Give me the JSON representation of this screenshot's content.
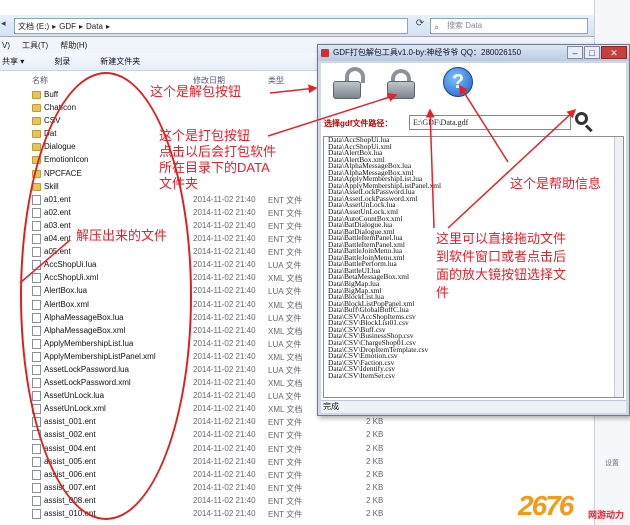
{
  "explorer": {
    "breadcrumb": [
      "文档 (E:)",
      "GDF",
      "Data"
    ],
    "search_placeholder": "搜索 Data",
    "menu": [
      "V)",
      "工具(T)",
      "帮助(H)"
    ],
    "toolbar": [
      "共享 ▾",
      "刻录",
      "新建文件夹"
    ],
    "columns": {
      "name": "名称",
      "date": "修改日期",
      "type": "类型"
    },
    "files": [
      {
        "name": "Buff",
        "date": "",
        "type": "",
        "size": "",
        "kind": "folder"
      },
      {
        "name": "ChatIcon",
        "date": "",
        "type": "",
        "size": "",
        "kind": "folder"
      },
      {
        "name": "CSV",
        "date": "",
        "type": "",
        "size": "",
        "kind": "folder"
      },
      {
        "name": "Dat",
        "date": "",
        "type": "",
        "size": "",
        "kind": "folder"
      },
      {
        "name": "Dialogue",
        "date": "",
        "type": "",
        "size": "",
        "kind": "folder"
      },
      {
        "name": "EmotionIcon",
        "date": "",
        "type": "",
        "size": "",
        "kind": "folder"
      },
      {
        "name": "NPCFACE",
        "date": "",
        "type": "",
        "size": "",
        "kind": "folder"
      },
      {
        "name": "Skill",
        "date": "",
        "type": "",
        "size": "",
        "kind": "folder"
      },
      {
        "name": "a01.ent",
        "date": "2014-11-02 21:40",
        "type": "ENT 文件",
        "size": "",
        "kind": "doc"
      },
      {
        "name": "a02.ent",
        "date": "2014-11-02 21:40",
        "type": "ENT 文件",
        "size": "",
        "kind": "doc"
      },
      {
        "name": "a03.ent",
        "date": "2014-11-02 21:40",
        "type": "ENT 文件",
        "size": "",
        "kind": "doc"
      },
      {
        "name": "a04.ent",
        "date": "2014-11-02 21:40",
        "type": "ENT 文件",
        "size": "",
        "kind": "doc"
      },
      {
        "name": "a05.ent",
        "date": "2014-11-02 21:40",
        "type": "ENT 文件",
        "size": "",
        "kind": "doc"
      },
      {
        "name": "AccShopUi.lua",
        "date": "2014-11-02 21:40",
        "type": "LUA 文件",
        "size": "",
        "kind": "doc"
      },
      {
        "name": "AccShopUi.xml",
        "date": "2014-11-02 21:40",
        "type": "XML 文档",
        "size": "",
        "kind": "doc"
      },
      {
        "name": "AlertBox.lua",
        "date": "2014-11-02 21:40",
        "type": "LUA 文件",
        "size": "",
        "kind": "doc"
      },
      {
        "name": "AlertBox.xml",
        "date": "2014-11-02 21:40",
        "type": "XML 文档",
        "size": "",
        "kind": "doc"
      },
      {
        "name": "AlphaMessageBox.lua",
        "date": "2014-11-02 21:40",
        "type": "LUA 文件",
        "size": "",
        "kind": "doc"
      },
      {
        "name": "AlphaMessageBox.xml",
        "date": "2014-11-02 21:40",
        "type": "XML 文档",
        "size": "",
        "kind": "doc"
      },
      {
        "name": "ApplyMembershipList.lua",
        "date": "2014-11-02 21:40",
        "type": "LUA 文件",
        "size": "",
        "kind": "doc"
      },
      {
        "name": "ApplyMembershipListPanel.xml",
        "date": "2014-11-02 21:40",
        "type": "XML 文档",
        "size": "",
        "kind": "doc"
      },
      {
        "name": "AssetLockPassword.lua",
        "date": "2014-11-02 21:40",
        "type": "LUA 文件",
        "size": "",
        "kind": "doc"
      },
      {
        "name": "AssetLockPassword.xml",
        "date": "2014-11-02 21:40",
        "type": "XML 文档",
        "size": "",
        "kind": "doc"
      },
      {
        "name": "AssetUnLock.lua",
        "date": "2014-11-02 21:40",
        "type": "LUA 文件",
        "size": "",
        "kind": "doc"
      },
      {
        "name": "AssetUnLock.xml",
        "date": "2014-11-02 21:40",
        "type": "XML 文档",
        "size": "",
        "kind": "doc"
      },
      {
        "name": "assist_001.ent",
        "date": "2014-11-02 21:40",
        "type": "ENT 文件",
        "size": "2 KB",
        "kind": "doc"
      },
      {
        "name": "assist_002.ent",
        "date": "2014-11-02 21:40",
        "type": "ENT 文件",
        "size": "2 KB",
        "kind": "doc"
      },
      {
        "name": "assist_004.ent",
        "date": "2014-11-02 21:40",
        "type": "ENT 文件",
        "size": "2 KB",
        "kind": "doc"
      },
      {
        "name": "assist_005.ent",
        "date": "2014-11-02 21:40",
        "type": "ENT 文件",
        "size": "2 KB",
        "kind": "doc"
      },
      {
        "name": "assist_006.ent",
        "date": "2014-11-02 21:40",
        "type": "ENT 文件",
        "size": "2 KB",
        "kind": "doc"
      },
      {
        "name": "assist_007.ent",
        "date": "2014-11-02 21:40",
        "type": "ENT 文件",
        "size": "2 KB",
        "kind": "doc"
      },
      {
        "name": "assist_008.ent",
        "date": "2014-11-02 21:40",
        "type": "ENT 文件",
        "size": "2 KB",
        "kind": "doc"
      },
      {
        "name": "assist_010.ent",
        "date": "2014-11-02 21:40",
        "type": "ENT 文件",
        "size": "2 KB",
        "kind": "doc"
      }
    ],
    "status_right": "设置"
  },
  "tool": {
    "title": "GDF打包解包工具v1.0-by:神经爷爷 QQ：280026150",
    "path_label": "选择gdf文件路径：",
    "path_value": "E:\\GDF\\Data.gdf",
    "help_glyph": "?",
    "list": [
      "Data\\AccShopUi.lua",
      "Data\\AccShopUi.xml",
      "Data\\AlertBox.lua",
      "Data\\AlertBox.xml",
      "Data\\AlphaMessageBox.lua",
      "Data\\AlphaMessageBox.xml",
      "Data\\ApplyMembershipList.lua",
      "Data\\ApplyMembershipListPanel.xml",
      "Data\\AssetLockPassword.lua",
      "Data\\AssetLockPassword.xml",
      "Data\\AssetUnLock.lua",
      "Data\\AssetUnLock.xml",
      "Data\\AutoCountBox.xml",
      "Data\\BatDialogue.lua",
      "Data\\BatDialogue.xml",
      "Data\\BattleItemPanel.lua",
      "Data\\BattleItemPanel.xml",
      "Data\\BattleJoinMenu.lua",
      "Data\\BattleJoinMenu.xml",
      "Data\\BattlePerform.lua",
      "Data\\BattleUI.lua",
      "Data\\BetaMessageBox.xml",
      "Data\\BigMap.lua",
      "Data\\BigMap.xml",
      "Data\\BlockList.lua",
      "Data\\BlockListPopPanel.xml",
      "Data\\Buff\\GlobalBuffC.lua",
      "Data\\CSV\\AccShopItems.csv",
      "Data\\CSV\\BlockList01.csv",
      "Data\\CSV\\Buff.csv",
      "Data\\CSV\\BusinessShop.csv",
      "Data\\CSV\\ChargeShop01.csv",
      "Data\\CSV\\DropItemTemplate.csv",
      "Data\\CSV\\Emotion.csv",
      "Data\\CSV\\Faction.csv",
      "Data\\CSV\\Identify.csv",
      "Data\\CSV\\ItemSet.csv"
    ],
    "status": "完成"
  },
  "annotations": {
    "unpack": "这个是解包按钮",
    "pack": "这个是打包按钮\n点击以后会打包软件\n所在目录下的DATA\n文件夹",
    "help": "这个是帮助信息",
    "drag": "这里可以直接拖动文件\n到软件窗口或者点击后\n面的放大镜按钮选择文\n件",
    "extracted": "解压出来的文件"
  },
  "logo": {
    "number": "2676",
    "text": "网游动力"
  }
}
